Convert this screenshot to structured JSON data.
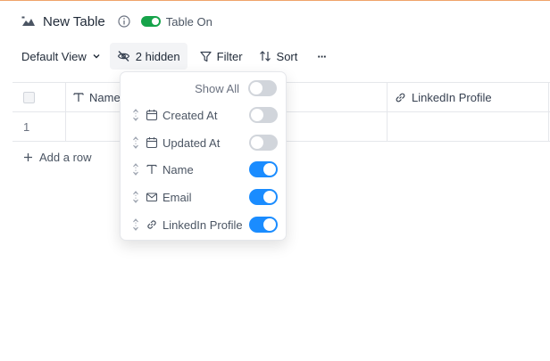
{
  "header": {
    "title": "New Table",
    "status_label": "Table On",
    "status_color": "#16a34a",
    "table_icon": "table-icon",
    "info_icon": "info-icon"
  },
  "toolbar": {
    "view_label": "Default View",
    "hidden_label": "2 hidden",
    "filter_label": "Filter",
    "sort_label": "Sort",
    "more_label": "···"
  },
  "grid": {
    "columns": [
      {
        "label": "Name",
        "icon": "text-type-icon"
      },
      {
        "label": "LinkedIn Profile",
        "icon": "link-icon"
      }
    ],
    "rows": [
      {
        "number": "1"
      }
    ],
    "add_row_label": "Add a row"
  },
  "fields_popover": {
    "show_all_label": "Show All",
    "show_all_enabled": false,
    "accent_color": "#1a8cff",
    "fields": [
      {
        "label": "Created At",
        "icon": "calendar-icon",
        "visible": false
      },
      {
        "label": "Updated At",
        "icon": "calendar-icon",
        "visible": false
      },
      {
        "label": "Name",
        "icon": "text-type-icon",
        "visible": true
      },
      {
        "label": "Email",
        "icon": "mail-icon",
        "visible": true
      },
      {
        "label": "LinkedIn Profile",
        "icon": "link-icon",
        "visible": true
      }
    ]
  }
}
